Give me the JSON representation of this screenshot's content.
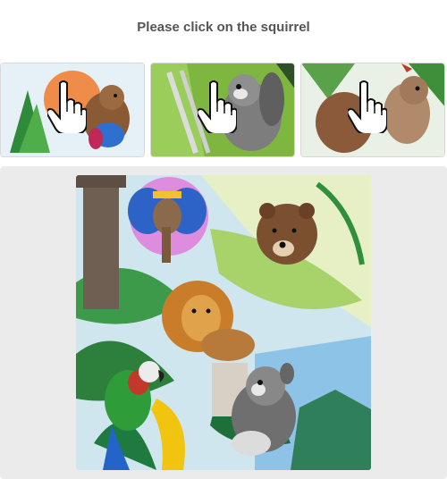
{
  "prompt": {
    "text": "Please click on the squirrel"
  },
  "examples": [
    {
      "subject": "squirrel",
      "style": "watercolor-colorful"
    },
    {
      "subject": "squirrel",
      "style": "pencil-sketch-green"
    },
    {
      "subject": "squirrel",
      "style": "watercolor-soft"
    }
  ],
  "scene": {
    "animals": [
      "elephant",
      "bear",
      "lion",
      "parrot",
      "squirrel"
    ],
    "background": "jungle"
  },
  "colors": {
    "panel": "#ebebeb",
    "prompt_text": "#555555"
  }
}
